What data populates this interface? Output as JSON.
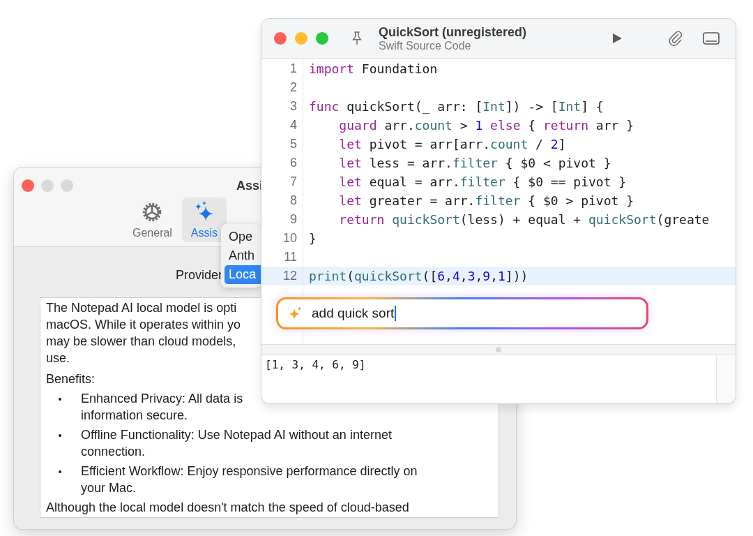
{
  "settings_window": {
    "title": "Assi",
    "toolbar_tabs": [
      {
        "label": "General",
        "selected": false
      },
      {
        "label": "Assis",
        "selected": true
      }
    ],
    "provider_label": "Provider",
    "provider_menu": [
      {
        "label": "Ope",
        "selected": false
      },
      {
        "label": "Anth",
        "selected": false
      },
      {
        "label": "Loca",
        "selected": true
      }
    ],
    "description": {
      "intro_lines": [
        "The Notepad AI local model is opti",
        "macOS. While it operates within yo",
        "may be slower than cloud models,",
        "use."
      ],
      "benefits_heading": "Benefits:",
      "benefits": [
        {
          "lines": [
            "Enhanced Privacy: All data is",
            "information secure."
          ]
        },
        {
          "lines": [
            "Offline Functionality: Use Notepad AI without an internet",
            "connection."
          ]
        },
        {
          "lines": [
            "Efficient Workflow: Enjoy responsive performance directly on",
            "your Mac."
          ]
        }
      ],
      "closing": "Although the local model doesn't match the speed of cloud-based"
    }
  },
  "editor_window": {
    "title": "QuickSort (unregistered)",
    "subtitle": "Swift Source Code",
    "code_lines": [
      {
        "number": "1",
        "current": false,
        "tokens": [
          {
            "kind": "keyword",
            "text": "import"
          },
          {
            "kind": "plain",
            "text": " Foundation"
          }
        ]
      },
      {
        "number": "2",
        "current": false
      },
      {
        "number": "3",
        "current": false,
        "tokens": [
          {
            "kind": "keyword",
            "text": "func"
          },
          {
            "kind": "plain",
            "text": " quickSort(_ arr: ["
          },
          {
            "kind": "type",
            "text": "Int"
          },
          {
            "kind": "plain",
            "text": "]) -> ["
          },
          {
            "kind": "type",
            "text": "Int"
          },
          {
            "kind": "plain",
            "text": "] {"
          }
        ]
      },
      {
        "number": "4",
        "current": false,
        "tokens": [
          {
            "kind": "keyword",
            "text": "    guard"
          },
          {
            "kind": "plain",
            "text": " arr."
          },
          {
            "kind": "function",
            "text": "count"
          },
          {
            "kind": "plain",
            "text": " > "
          },
          {
            "kind": "number",
            "text": "1"
          },
          {
            "kind": "keyword",
            "text": " else"
          },
          {
            "kind": "plain",
            "text": " { "
          },
          {
            "kind": "keyword",
            "text": "return"
          },
          {
            "kind": "plain",
            "text": " arr }"
          }
        ]
      },
      {
        "number": "5",
        "current": false,
        "tokens": [
          {
            "kind": "keyword",
            "text": "    let"
          },
          {
            "kind": "plain",
            "text": " pivot = arr[arr."
          },
          {
            "kind": "function",
            "text": "count"
          },
          {
            "kind": "plain",
            "text": " / "
          },
          {
            "kind": "number",
            "text": "2"
          },
          {
            "kind": "plain",
            "text": "]"
          }
        ]
      },
      {
        "number": "6",
        "current": false,
        "tokens": [
          {
            "kind": "keyword",
            "text": "    let"
          },
          {
            "kind": "plain",
            "text": " less = arr."
          },
          {
            "kind": "function",
            "text": "filter"
          },
          {
            "kind": "plain",
            "text": " { $0 < pivot }"
          }
        ]
      },
      {
        "number": "7",
        "current": false,
        "tokens": [
          {
            "kind": "keyword",
            "text": "    let"
          },
          {
            "kind": "plain",
            "text": " equal = arr."
          },
          {
            "kind": "function",
            "text": "filter"
          },
          {
            "kind": "plain",
            "text": " { $0 == pivot }"
          }
        ]
      },
      {
        "number": "8",
        "current": false,
        "tokens": [
          {
            "kind": "keyword",
            "text": "    let"
          },
          {
            "kind": "plain",
            "text": " greater = arr."
          },
          {
            "kind": "function",
            "text": "filter"
          },
          {
            "kind": "plain",
            "text": " { $0 > pivot }"
          }
        ]
      },
      {
        "number": "9",
        "current": false,
        "tokens": [
          {
            "kind": "keyword",
            "text": "    return "
          },
          {
            "kind": "function",
            "text": "quickSort"
          },
          {
            "kind": "plain",
            "text": "(less) + equal + "
          },
          {
            "kind": "function",
            "text": "quickSort"
          },
          {
            "kind": "plain",
            "text": "(greate"
          }
        ]
      },
      {
        "number": "10",
        "current": false,
        "tokens": [
          {
            "kind": "plain",
            "text": "}"
          }
        ]
      },
      {
        "number": "11",
        "current": false
      },
      {
        "number": "12",
        "current": true,
        "tokens": [
          {
            "kind": "function",
            "text": "print"
          },
          {
            "kind": "plain",
            "text": "("
          },
          {
            "kind": "function",
            "text": "quickSort"
          },
          {
            "kind": "plain",
            "text": "(["
          },
          {
            "kind": "number",
            "text": "6"
          },
          {
            "kind": "plain",
            "text": ","
          },
          {
            "kind": "number",
            "text": "4"
          },
          {
            "kind": "plain",
            "text": ","
          },
          {
            "kind": "number",
            "text": "3"
          },
          {
            "kind": "plain",
            "text": ","
          },
          {
            "kind": "number",
            "text": "9"
          },
          {
            "kind": "plain",
            "text": ","
          },
          {
            "kind": "number",
            "text": "1"
          },
          {
            "kind": "plain",
            "text": "]))"
          }
        ]
      }
    ],
    "prompt": {
      "value": "add quick sort"
    },
    "output": "[1, 3, 4, 6, 9]"
  }
}
